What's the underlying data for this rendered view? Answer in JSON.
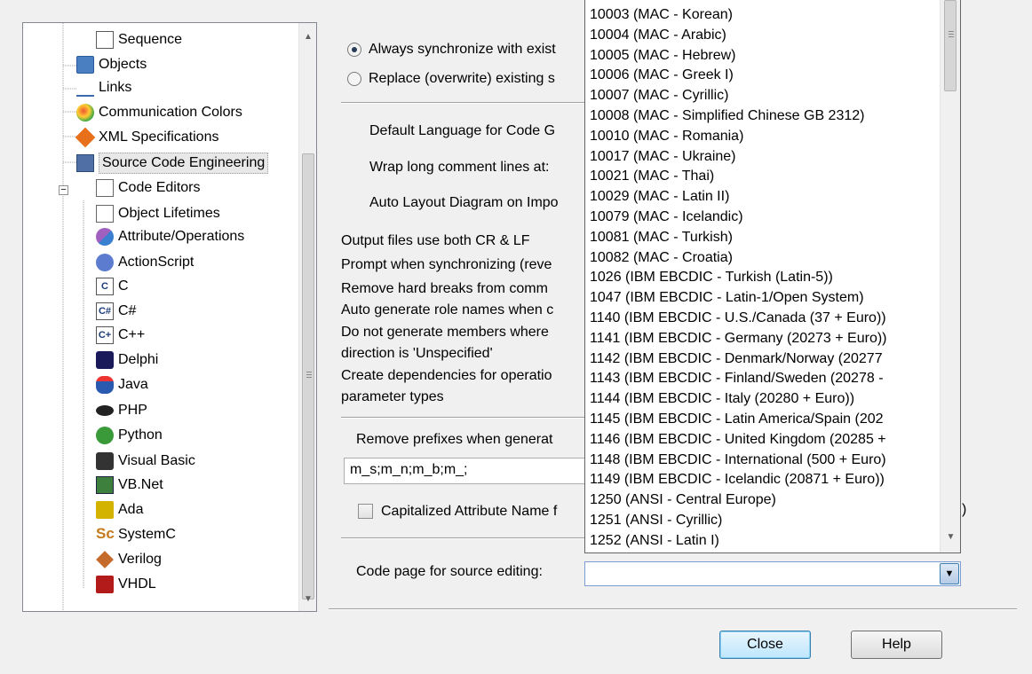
{
  "tree": {
    "items": [
      {
        "label": "Sequence",
        "icon": "sequence-icon"
      },
      {
        "label": "Objects",
        "icon": "objects-icon"
      },
      {
        "label": "Links",
        "icon": "links-icon"
      },
      {
        "label": "Communication Colors",
        "icon": "palette-icon"
      },
      {
        "label": "XML Specifications",
        "icon": "xml-icon"
      },
      {
        "label": "Source Code Engineering",
        "icon": "source-code-icon"
      },
      {
        "label": "Code Editors",
        "icon": "code-editor-icon"
      },
      {
        "label": "Object Lifetimes",
        "icon": "object-lifetimes-icon"
      },
      {
        "label": "Attribute/Operations",
        "icon": "attribute-operations-icon"
      },
      {
        "label": "ActionScript",
        "icon": "actionscript-icon"
      },
      {
        "label": "C",
        "icon": "c-language-icon"
      },
      {
        "label": "C#",
        "icon": "csharp-icon"
      },
      {
        "label": "C++",
        "icon": "cpp-icon"
      },
      {
        "label": "Delphi",
        "icon": "delphi-icon"
      },
      {
        "label": "Java",
        "icon": "java-icon"
      },
      {
        "label": "PHP",
        "icon": "php-icon"
      },
      {
        "label": "Python",
        "icon": "python-icon"
      },
      {
        "label": "Visual Basic",
        "icon": "visual-basic-icon"
      },
      {
        "label": "VB.Net",
        "icon": "vbnet-icon"
      },
      {
        "label": "Ada",
        "icon": "ada-icon"
      },
      {
        "label": "SystemC",
        "icon": "systemc-icon"
      },
      {
        "label": "Verilog",
        "icon": "verilog-icon"
      },
      {
        "label": "VHDL",
        "icon": "vhdl-icon"
      }
    ],
    "selected": "Source Code Engineering",
    "expander": "−",
    "scroll_up": "▲",
    "scroll_down": "▼"
  },
  "options": {
    "radio_always": "Always synchronize with exist",
    "radio_replace": "Replace (overwrite) existing s",
    "default_language": "Default Language for Code G",
    "wrap_comments": "Wrap long comment lines at:",
    "auto_layout": "Auto Layout Diagram on Impo",
    "crlf": "Output files use both CR & LF",
    "prompt_sync": "Prompt when synchronizing (reve",
    "remove_breaks": "Remove hard breaks from  comm",
    "auto_role_names": "Auto generate role names when c",
    "no_members_1": "Do not generate members where",
    "no_members_2": "direction is 'Unspecified'",
    "create_deps_1": "Create dependencies for operatio",
    "create_deps_2": "parameter types",
    "remove_prefixes": "Remove prefixes when generat",
    "prefixes_value": "m_s;m_n;m_b;m_;",
    "capitalized": "Capitalized Attribute Name f",
    "code_page_label": "Code page for source editing:",
    "code_page_value": "",
    "trailing_paren": ")"
  },
  "dropdown": {
    "items": [
      "10003 (MAC - Korean)",
      "10004 (MAC - Arabic)",
      "10005 (MAC - Hebrew)",
      "10006 (MAC - Greek I)",
      "10007 (MAC - Cyrillic)",
      "10008 (MAC - Simplified Chinese GB 2312)",
      "10010 (MAC - Romania)",
      "10017 (MAC - Ukraine)",
      "10021 (MAC - Thai)",
      "10029 (MAC - Latin II)",
      "10079 (MAC - Icelandic)",
      "10081 (MAC - Turkish)",
      "10082 (MAC - Croatia)",
      "1026  (IBM EBCDIC - Turkish (Latin-5))",
      "1047  (IBM EBCDIC - Latin-1/Open System)",
      "1140  (IBM EBCDIC - U.S./Canada (37 + Euro))",
      "1141  (IBM EBCDIC - Germany (20273 + Euro))",
      "1142  (IBM EBCDIC - Denmark/Norway (20277",
      "1143  (IBM EBCDIC - Finland/Sweden (20278 -",
      "1144  (IBM EBCDIC - Italy (20280 + Euro))",
      "1145  (IBM EBCDIC - Latin America/Spain (202",
      "1146  (IBM EBCDIC - United Kingdom (20285 +",
      "1148  (IBM EBCDIC - International (500 + Euro)",
      "1149  (IBM EBCDIC - Icelandic (20871 + Euro))",
      "1250  (ANSI - Central Europe)",
      "1251  (ANSI - Cyrillic)",
      "1252  (ANSI - Latin I)"
    ],
    "scroll_up": "▲",
    "scroll_down": "▼",
    "open_arrow": "▼"
  },
  "buttons": {
    "close": "Close",
    "help": "Help"
  },
  "colors": {
    "window_bg": "#f0f0f0",
    "accent": "#3c7fb1"
  }
}
